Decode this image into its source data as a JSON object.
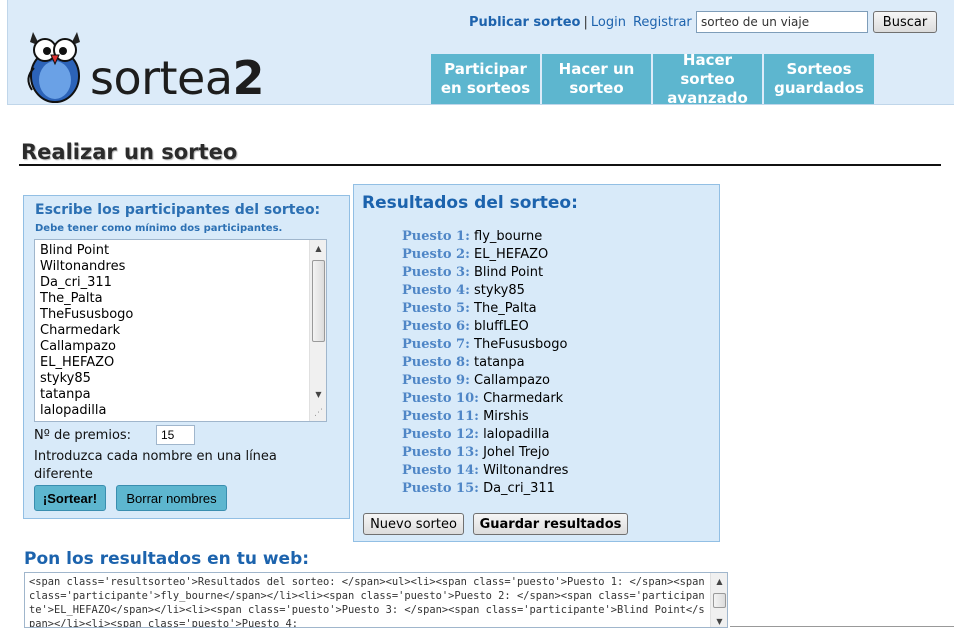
{
  "header": {
    "logo_text_light": "sortea",
    "logo_text_bold": "2",
    "links": {
      "publicar": "Publicar sorteo",
      "separator": "|",
      "login": "Login",
      "registrar": "Registrar"
    },
    "search": {
      "value": "sorteo de un viaje",
      "button_label": "Buscar"
    },
    "nav": [
      {
        "label": "Participar en sorteos"
      },
      {
        "label": "Hacer un sorteo"
      },
      {
        "label": "Hacer sorteo avanzado"
      },
      {
        "label": "Sorteos guardados"
      }
    ]
  },
  "page": {
    "title": "Realizar un sorteo"
  },
  "participants": {
    "heading": "Escribe los participantes del sorteo:",
    "note": "Debe tener como mínimo dos participantes.",
    "names": [
      "Blind Point",
      "Wiltonandres",
      "Da_cri_311",
      "The_Palta",
      "TheFususbogo",
      "Charmedark",
      "Callampazo",
      "EL_HEFAZO",
      "styky85",
      "tatanpa",
      "lalopadilla"
    ],
    "premios_label": "Nº de premios:",
    "premios_value": "15",
    "instructions": "Introduzca cada nombre en una línea diferente",
    "sortear_label": "¡Sortear!",
    "borrar_label": "Borrar nombres"
  },
  "results": {
    "heading": "Resultados del sorteo:",
    "items": [
      {
        "place": "Puesto 1:",
        "name": "fly_bourne"
      },
      {
        "place": "Puesto 2:",
        "name": "EL_HEFAZO"
      },
      {
        "place": "Puesto 3:",
        "name": "Blind Point"
      },
      {
        "place": "Puesto 4:",
        "name": "styky85"
      },
      {
        "place": "Puesto 5:",
        "name": "The_Palta"
      },
      {
        "place": "Puesto 6:",
        "name": "bluffLEO"
      },
      {
        "place": "Puesto 7:",
        "name": "TheFususbogo"
      },
      {
        "place": "Puesto 8:",
        "name": "tatanpa"
      },
      {
        "place": "Puesto 9:",
        "name": "Callampazo"
      },
      {
        "place": "Puesto 10:",
        "name": "Charmedark"
      },
      {
        "place": "Puesto 11:",
        "name": "Mirshis"
      },
      {
        "place": "Puesto 12:",
        "name": "lalopadilla"
      },
      {
        "place": "Puesto 13:",
        "name": "Johel Trejo"
      },
      {
        "place": "Puesto 14:",
        "name": "Wiltonandres"
      },
      {
        "place": "Puesto 15:",
        "name": "Da_cri_311"
      }
    ],
    "nuevo_label": "Nuevo sorteo",
    "guardar_label": "Guardar resultados"
  },
  "embed": {
    "heading": "Pon los resultados en tu web:",
    "code": "<span class='resultsorteo'>Resultados del sorteo: </span><ul><li><span class='puesto'>Puesto 1: </span><span class='participante'>fly_bourne</span></li><li><span class='puesto'>Puesto 2: </span><span class='participante'>EL_HEFAZO</span></li><li><span class='puesto'>Puesto 3: </span><span class='participante'>Blind Point</span></li><li><span class='puesto'>Puesto 4:"
  },
  "colors": {
    "header_bg": "#dcebf9",
    "nav_tab": "#5db6cf",
    "panel_bg": "#d8eaf9",
    "accent_blue": "#1c63ad"
  },
  "icons": {
    "logo": "owl-mascot-icon",
    "scroll_up": "arrow-up-icon",
    "scroll_down": "arrow-down-icon",
    "resize": "resize-grip-icon"
  }
}
